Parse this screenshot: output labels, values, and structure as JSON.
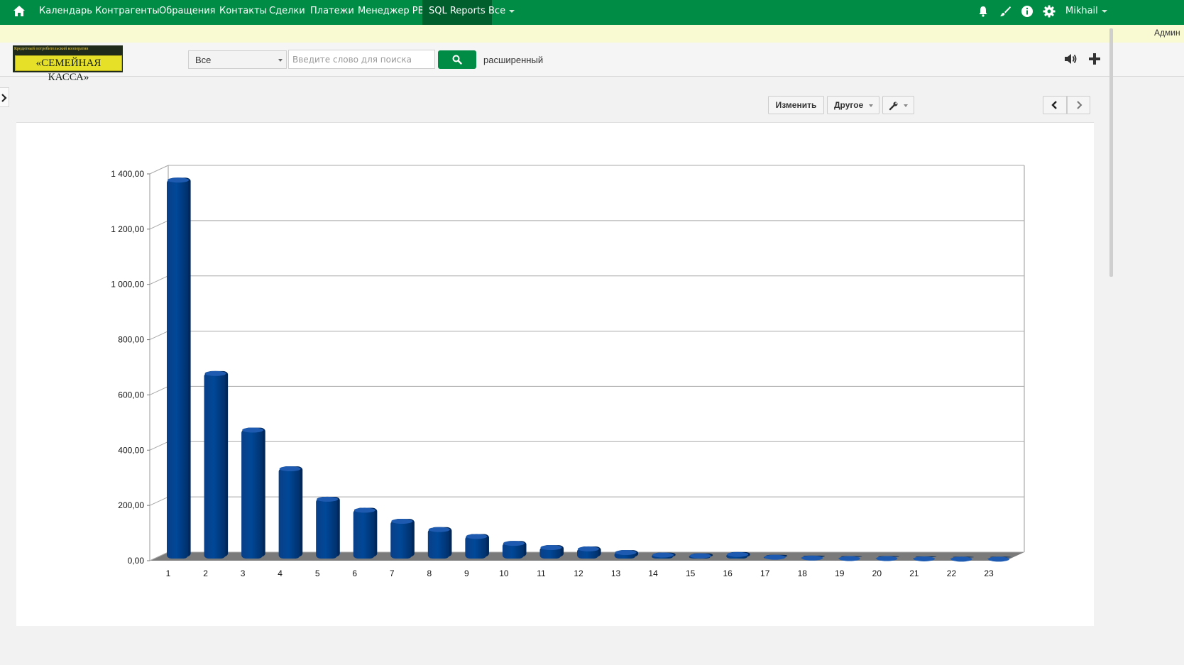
{
  "topnav": {
    "items": [
      {
        "label": "Календарь"
      },
      {
        "label": "Контрагенты"
      },
      {
        "label": "Обращения"
      },
      {
        "label": "Контакты"
      },
      {
        "label": "Сделки"
      },
      {
        "label": "Платежи"
      },
      {
        "label": "Менеджер PBX"
      },
      {
        "label": "SQL Reports"
      },
      {
        "label": "Все"
      }
    ],
    "user": "Mikhail"
  },
  "notice": {
    "text": "Админ"
  },
  "header": {
    "logo_top": "Кредитный потребительский кооператив",
    "logo_main": "«СЕМЕЙНАЯ КАССА»",
    "search_scope": "Все",
    "search_placeholder": "Введите слово для поиска",
    "advanced_label": "расширенный"
  },
  "toolbar": {
    "edit_label": "Изменить",
    "other_label": "Другое"
  },
  "colors": {
    "nav_green": "#008c45",
    "bar_fill": "#004898"
  },
  "chart_data": {
    "type": "bar",
    "categories": [
      "1",
      "2",
      "3",
      "4",
      "5",
      "6",
      "7",
      "8",
      "9",
      "10",
      "11",
      "12",
      "13",
      "14",
      "15",
      "16",
      "17",
      "18",
      "19",
      "20",
      "21",
      "22",
      "23"
    ],
    "values": [
      1375,
      675,
      470,
      330,
      220,
      180,
      140,
      110,
      85,
      60,
      45,
      40,
      27,
      18,
      15,
      20,
      10,
      7,
      5,
      5,
      4,
      3,
      3
    ],
    "ylim": [
      0,
      1400
    ],
    "yticks": [
      "0,00",
      "200,00",
      "400,00",
      "600,00",
      "800,00",
      "1 000,00",
      "1 200,00",
      "1 400,00"
    ],
    "grid": true,
    "legend": "none"
  }
}
